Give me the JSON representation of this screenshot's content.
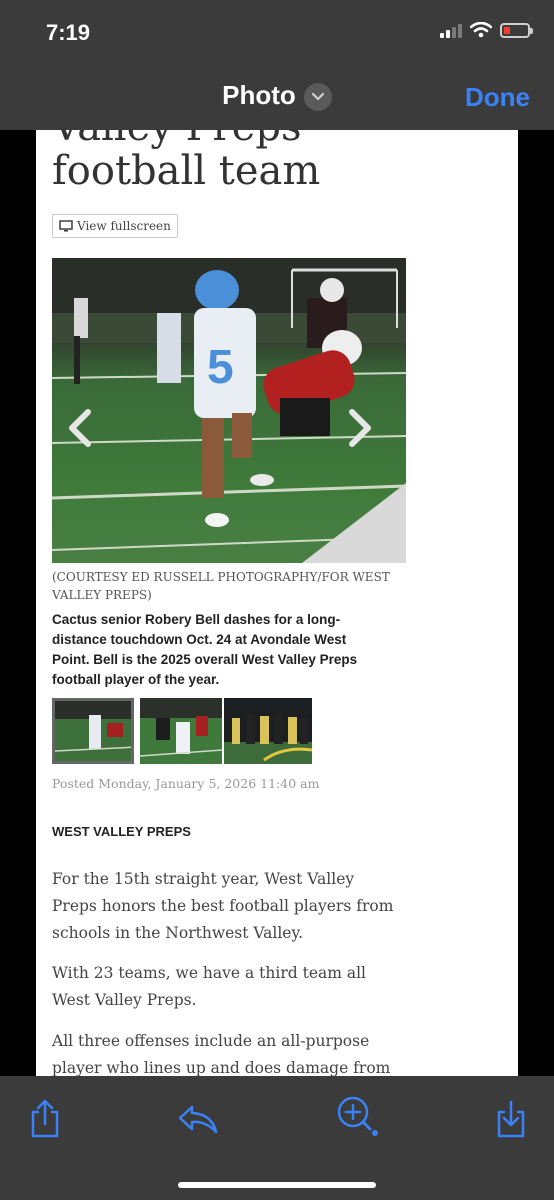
{
  "status_bar": {
    "time": "7:19"
  },
  "nav": {
    "title": "Photo",
    "done_label": "Done"
  },
  "article": {
    "headline_partial": "Valley Preps",
    "headline": "football team",
    "view_fullscreen_label": "View fullscreen",
    "photo_credit": "(COURTESY ED RUSSELL PHOTOGRAPHY/FOR WEST VALLEY PREPS)",
    "photo_caption": "Cactus senior Robery Bell dashes for a long-distance touchdown Oct. 24 at Avondale West Point. Bell is the 2025 overall West Valley Preps football player of the year.",
    "posted": "Posted Monday, January 5, 2026 11:40 am",
    "section": "WEST VALLEY PREPS",
    "paragraphs": [
      "For the 15th straight year, West Valley Preps honors the best football players from schools in the Northwest Valley.",
      "With 23 teams, we have a third team all West Valley Preps.",
      "All three offenses include an all-purpose player who lines up and does damage from"
    ]
  },
  "toolbar": {
    "icons": [
      "share-icon",
      "reply-icon",
      "zoom-icon",
      "save-icon"
    ]
  },
  "colors": {
    "accent": "#3a82f7",
    "bar": "#3b3b3b",
    "battery_low": "#ff3b30"
  }
}
